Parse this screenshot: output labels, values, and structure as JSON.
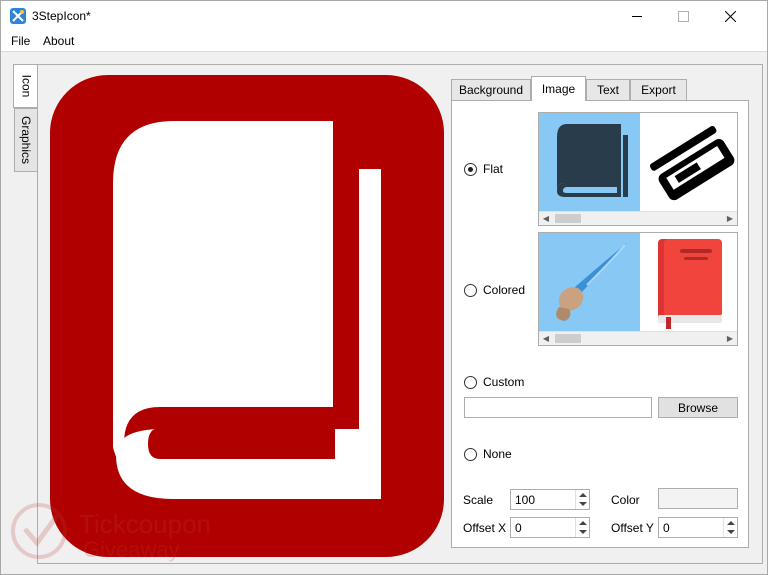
{
  "window": {
    "title": "3StepIcon*",
    "controls": {
      "minimize": "minimize",
      "maximize": "maximize",
      "close": "close"
    }
  },
  "menu": {
    "items": [
      "File",
      "About"
    ]
  },
  "side_tabs": [
    {
      "label": "Icon",
      "active": true
    },
    {
      "label": "Graphics",
      "active": false
    }
  ],
  "preview": {
    "background_color": "#b00000",
    "glyph_color": "#ffffff",
    "icon": "book-icon"
  },
  "tabs": [
    {
      "label": "Background",
      "active": false
    },
    {
      "label": "Image",
      "active": true
    },
    {
      "label": "Text",
      "active": false
    },
    {
      "label": "Export",
      "active": false
    }
  ],
  "image_panel": {
    "flat": {
      "label": "Flat",
      "checked": true,
      "thumbnails": [
        {
          "icon": "book-icon",
          "bg": "#87c8f5",
          "color": "#283c4b"
        },
        {
          "icon": "scanner-icon",
          "bg": "#ffffff",
          "color": "#000000"
        }
      ]
    },
    "colored": {
      "label": "Colored",
      "checked": false,
      "thumbnails": [
        {
          "icon": "paintbrush-icon",
          "bg": "#87c8f5"
        },
        {
          "icon": "red-book-icon",
          "bg": "#ffffff"
        }
      ]
    },
    "custom": {
      "label": "Custom",
      "checked": false,
      "value": "",
      "browse_label": "Browse"
    },
    "none": {
      "label": "None",
      "checked": false
    },
    "scale": {
      "label": "Scale",
      "value": "100"
    },
    "color": {
      "label": "Color",
      "value": ""
    },
    "offset_x": {
      "label": "Offset X",
      "value": "0"
    },
    "offset_y": {
      "label": "Offset Y",
      "value": "0"
    }
  },
  "watermark": {
    "line1": "Tickcoupon",
    "line2": "Giveaway"
  }
}
